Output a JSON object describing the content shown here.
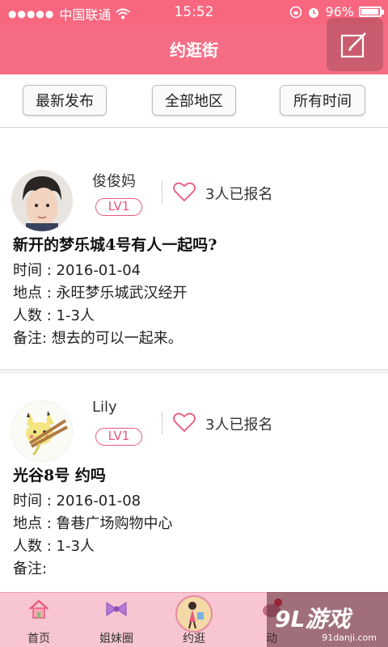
{
  "status_bar": {
    "carrier": "中国联通",
    "time": "15:52",
    "battery": "96%",
    "battery_level": 0.96
  },
  "header": {
    "title": "约逛街",
    "compose_icon": "edit-icon"
  },
  "filters": [
    {
      "label": "最新发布"
    },
    {
      "label": "全部地区"
    },
    {
      "label": "所有时间"
    }
  ],
  "posts": [
    {
      "username": "俊俊妈",
      "level": "LV1",
      "signup": "3人已报名",
      "title": "新开的梦乐城4号有人一起吗?",
      "time": "时间 : 2016-01-04",
      "place": "地点 : 永旺梦乐城武汉经开",
      "people": "人数 : 1-3人",
      "note": "备注: 想去的可以一起来。"
    },
    {
      "username": "Lily",
      "level": "LV1",
      "signup": "3人已报名",
      "title": "光谷8号 约吗",
      "time": "时间 : 2016-01-08",
      "place": "地点 : 鲁巷广场购物中心",
      "people": "人数 : 1-3人",
      "note": "备注:"
    }
  ],
  "nav": [
    {
      "label": "首页",
      "icon": "home-icon"
    },
    {
      "label": "姐妹圈",
      "icon": "bow-icon"
    },
    {
      "label": "约逛",
      "icon": "shopping-girl-icon"
    },
    {
      "label": "动",
      "icon": "dynamic-icon"
    }
  ],
  "watermark": {
    "brand": "9L游戏",
    "site": "91danji.com"
  },
  "colors": {
    "primary": "#f56d85",
    "level_badge": "#e8597a",
    "nav_bg": "#f7c6d2"
  }
}
